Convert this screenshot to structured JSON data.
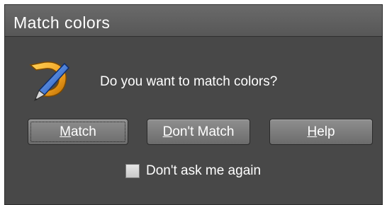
{
  "dialog": {
    "title": "Match colors",
    "icon": "xara-pen-icon",
    "message": "Do you want to match colors?"
  },
  "buttons": {
    "match": {
      "mnemonic": "M",
      "rest": "atch"
    },
    "dont_match": {
      "mnemonic": "D",
      "rest": "on't Match"
    },
    "help": {
      "mnemonic": "H",
      "rest": "elp"
    }
  },
  "checkbox": {
    "label": "Don't ask me again",
    "checked": false
  },
  "colors": {
    "dialog_bg": "#484848",
    "titlebar_bg": "#636363",
    "button_bg": "#7d7d7d",
    "text": "#ffffff",
    "icon_orange": "#f0a020",
    "icon_blue": "#2a6fd6"
  }
}
